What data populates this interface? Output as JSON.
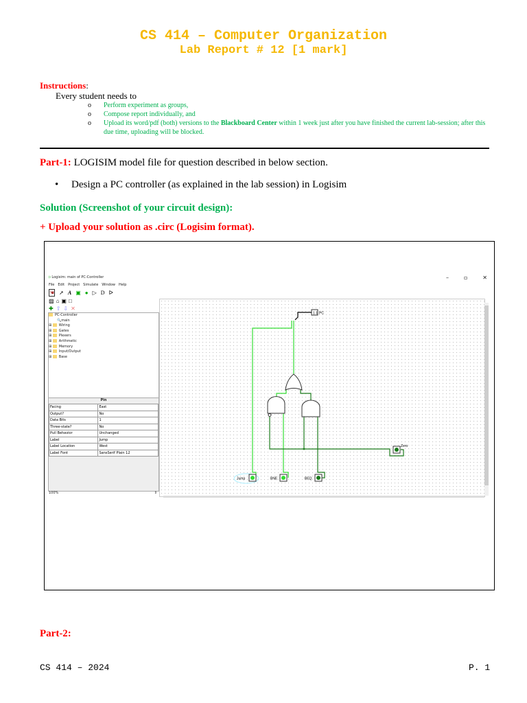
{
  "header": {
    "title": "CS 414 – Computer Organization",
    "subtitle": "Lab Report # 12 [1 mark]"
  },
  "instructions": {
    "label": "Instructions",
    "colon": ":",
    "intro": "Every student needs to",
    "bullet": "o",
    "items": [
      "Perform experiment as groups,",
      "Compose report individually, and"
    ],
    "item3_pre": "Upload its word/pdf (both) versions to the ",
    "item3_bold": "Blackboard Center",
    "item3_post": " within 1 week just after you have finished the current lab-session; after this due time, uploading will be blocked."
  },
  "part1": {
    "label": "Part-1:",
    "text": " LOGISIM model file for question described in below section.",
    "bullet": "Design a PC controller (as explained in the lab session) in Logisim",
    "solution": "Solution (Screenshot of your circuit design):",
    "upload": "+ Upload your solution as .circ (Logisim format)."
  },
  "logisim": {
    "window_title": "Logisim: main of PC-Controller",
    "menu": [
      "File",
      "Edit",
      "Project",
      "Simulate",
      "Window",
      "Help"
    ],
    "tree": {
      "project": "PC-Controller",
      "circuit": "main",
      "libs": [
        "Wiring",
        "Gates",
        "Plexers",
        "Arithmetic",
        "Memory",
        "Input/Output",
        "Base"
      ]
    },
    "props_title": "Pin",
    "props": [
      [
        "Facing",
        "East"
      ],
      [
        "Output?",
        "No"
      ],
      [
        "Data Bits",
        "1"
      ],
      [
        "Three-state?",
        "No"
      ],
      [
        "Pull Behavior",
        "Unchanged"
      ],
      [
        "Label",
        "Jump"
      ],
      [
        "Label Location",
        "West"
      ],
      [
        "Label Font",
        "SansSerif Plain 12"
      ]
    ],
    "zoom": "100%",
    "pins": {
      "jump": "Jump",
      "bne": "BNE",
      "beq": "BEQ",
      "zero": "Zero",
      "pc": "PC",
      "pc_value": "1 1",
      "pin_value": "1"
    },
    "controls": {
      "minimize": "–",
      "restore": "▫",
      "close": "✕"
    }
  },
  "part2": {
    "label": "Part-2:"
  },
  "footer": {
    "left": "CS 414 – 2024",
    "right": "P. 1"
  }
}
